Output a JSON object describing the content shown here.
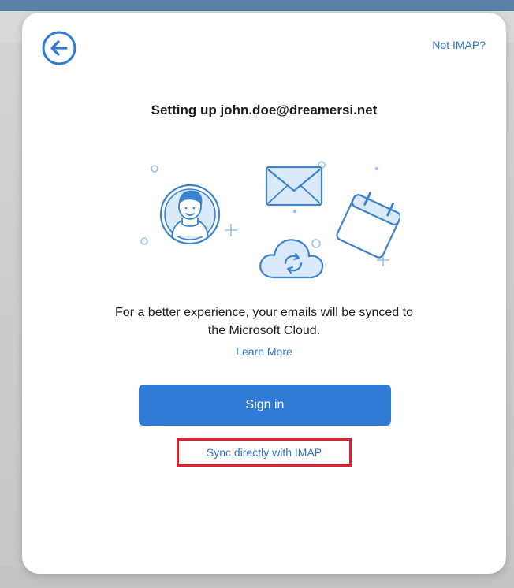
{
  "dialog": {
    "back_icon": "back-arrow-icon",
    "not_imap_link": "Not IMAP?",
    "title": "Setting up john.doe@dreamersi.net",
    "illustration": {
      "icons": [
        "avatar-icon",
        "envelope-icon",
        "cloud-sync-icon",
        "calendar-icon"
      ]
    },
    "message_line1": "For a better experience, your emails will be synced to",
    "message_line2": "the Microsoft Cloud.",
    "learn_more_link": "Learn More",
    "sign_in_button": "Sign in",
    "sync_imap_link": "Sync directly with IMAP"
  },
  "colors": {
    "accent": "#2f7ad6",
    "link": "#2b74c9",
    "highlight": "#e0202c",
    "illustration_stroke": "#3b82cf",
    "illustration_fill": "#dbeafb"
  }
}
